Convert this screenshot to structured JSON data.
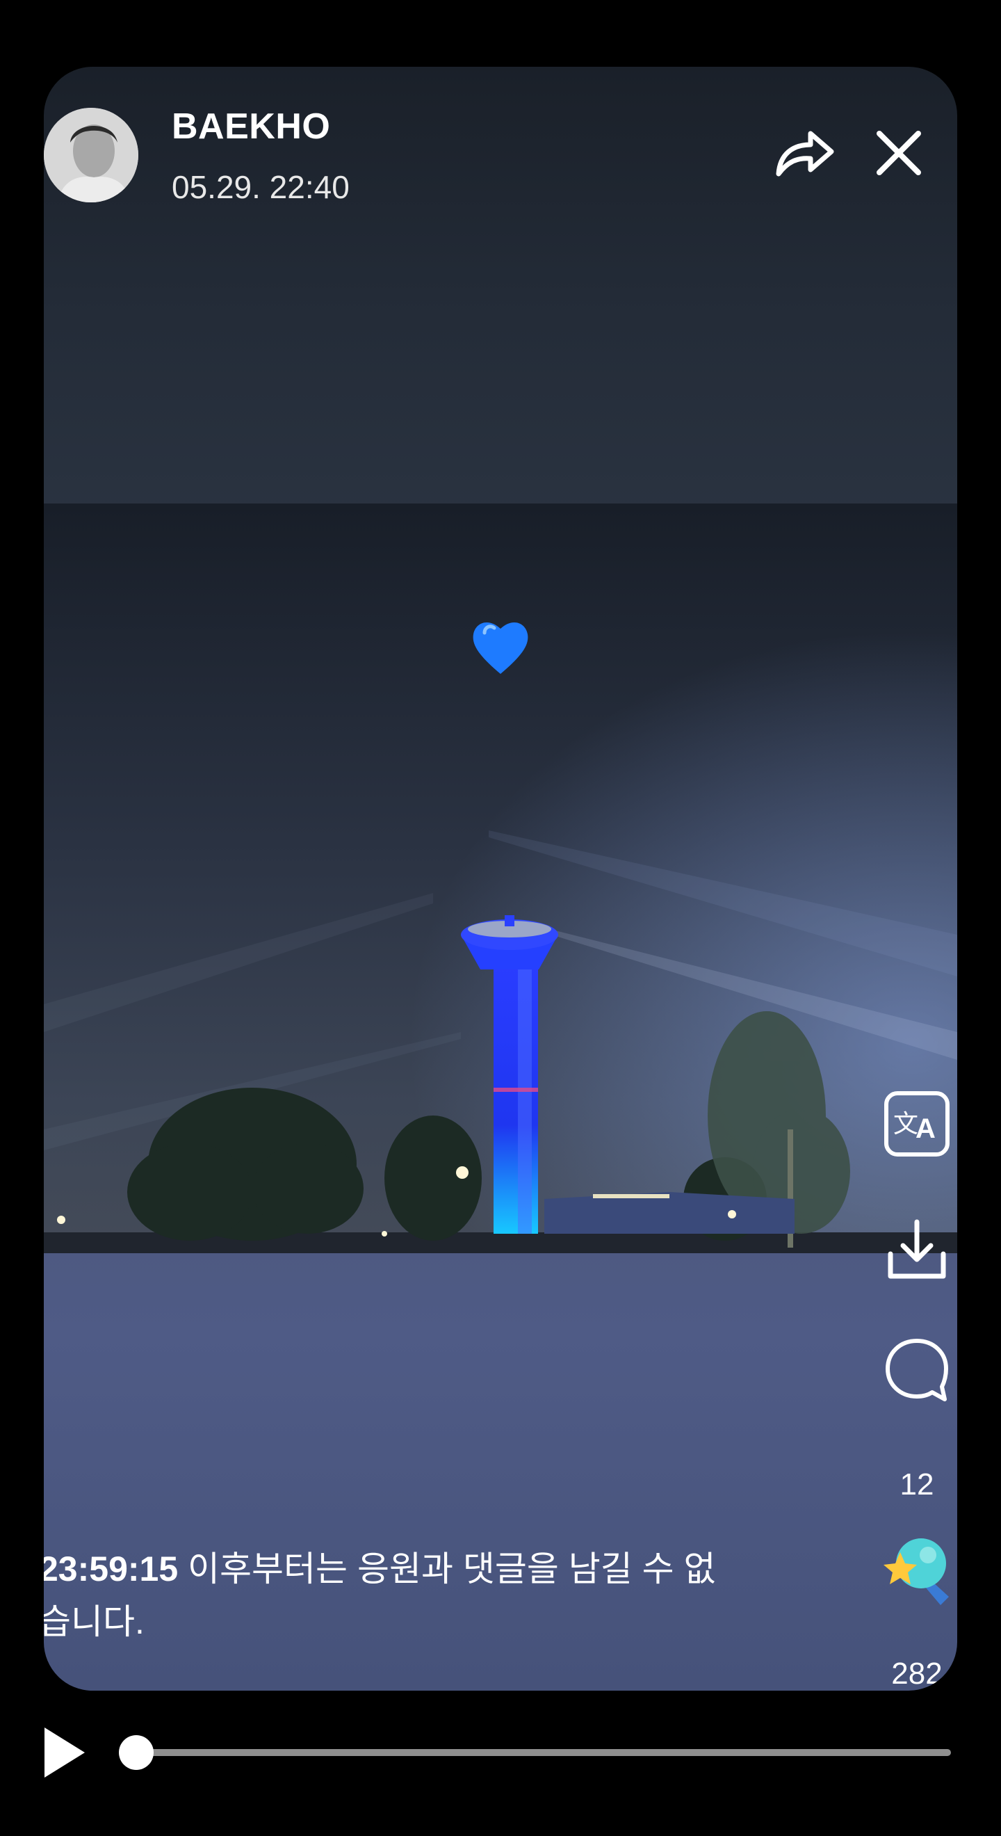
{
  "post": {
    "author": "BAEKHO",
    "timestamp": "05.29. 22:40",
    "avatar_icon": "profile-photo",
    "photo_sticker": "blue-heart-emoji"
  },
  "header": {
    "share_icon": "share-arrow-icon",
    "close_icon": "close-icon"
  },
  "side_actions": {
    "translate_icon": "translate-icon",
    "download_icon": "download-icon",
    "comment_icon": "comment-bubble-icon",
    "comment_count": "12",
    "cheer_icon": "cheer-star-icon",
    "cheer_count": "282"
  },
  "notice": {
    "time": "23:59:15",
    "text": " 이후부터는 응원과 댓글을 남길 수 없습니다."
  },
  "player": {
    "play_icon": "play-icon",
    "progress": 0.0
  },
  "colors": {
    "background": "#000000",
    "tower_blue": "#1f3cff",
    "heart_blue": "#1e7bff",
    "cheer_teal": "#4fd3d8",
    "cheer_yellow": "#ffc93c"
  }
}
